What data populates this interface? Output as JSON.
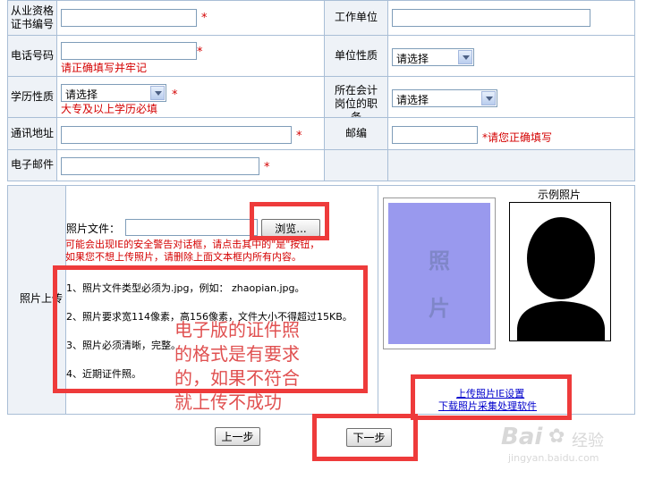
{
  "rows": [
    {
      "left_label": "从业资格证书编号",
      "right_label": "工作单位"
    },
    {
      "left_label": "电话号码",
      "left_hint": "请正确填写并牢记",
      "right_label": "单位性质",
      "right_select": "请选择"
    },
    {
      "left_label": "学历性质",
      "left_select": "请选择",
      "left_hint": "大专及以上学历必填",
      "right_label": "所在会计岗位的职务",
      "right_select": "请选择"
    },
    {
      "left_label": "通讯地址",
      "right_label": "邮编",
      "right_hint": "*请您正确填写"
    },
    {
      "left_label": "电子邮件"
    }
  ],
  "required_mark": "*",
  "photo": {
    "section_label": "照片上传",
    "file_label": "照片文件：",
    "browse_label": "浏览...",
    "warning_line1": "可能会出现IE的安全警告对话框，请点击其中的\"是\"按钮，",
    "warning_line2": "如果您不想上传照片，请删除上面文本框内所有内容。",
    "notes": [
      "1、照片文件类型必须为.jpg，例如： zhaopian.jpg。",
      "2、照片要求宽114像素，高156像素，文件大小不得超过15KB。",
      "3、照片必须清晰，完整。",
      "4、近期证件照。"
    ],
    "placeholder_text_1": "照",
    "placeholder_text_2": "片",
    "sample_title": "示例照片",
    "link_ie_settings": "上传照片IE设置",
    "link_download": "下载照片采集处理软件"
  },
  "buttons": {
    "prev": "上一步",
    "next": "下一步"
  },
  "annotation": {
    "line1": "电子版的证件照",
    "line2": "的格式是有要求",
    "line3": "的，如果不符合",
    "line4": "就上传不成功"
  },
  "watermark": {
    "brand": "Bai",
    "brand_suffix": "经验",
    "url": "jingyan.baidu.com"
  },
  "colors": {
    "border": "#a9bed6",
    "label_bg": "#eef2f7",
    "required": "#d40000",
    "highlight": "#ee3b3b",
    "photo_bg": "#9999ee"
  }
}
